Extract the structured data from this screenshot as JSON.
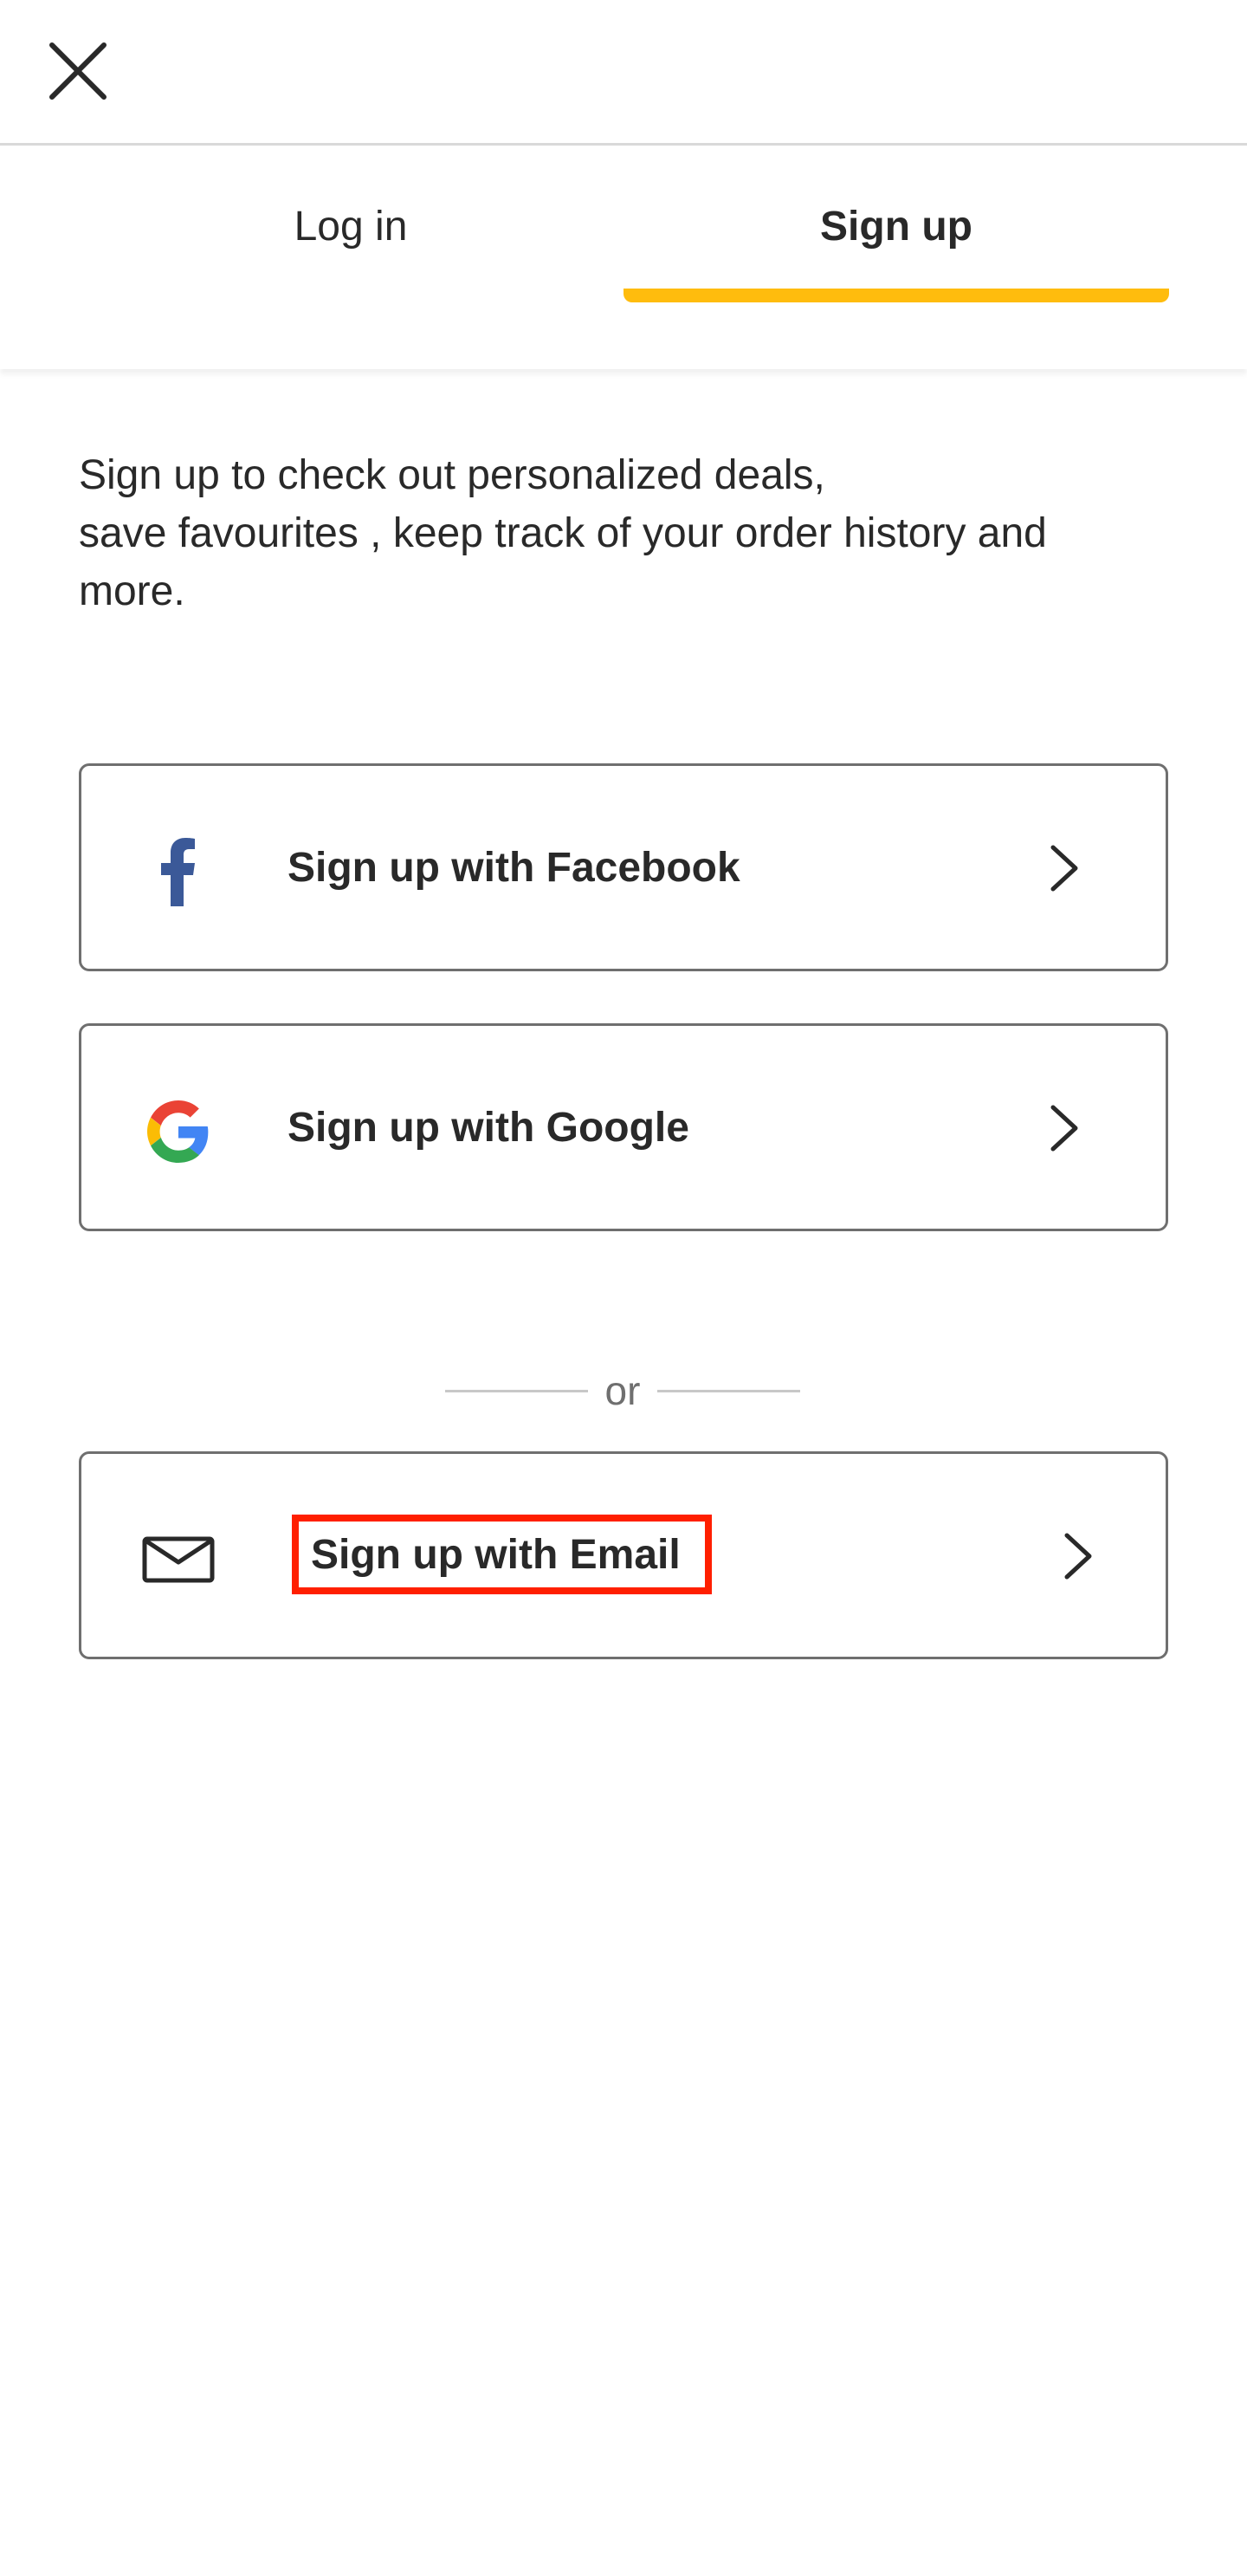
{
  "header": {
    "close_icon": "close-icon"
  },
  "tabs": [
    {
      "label": "Log in",
      "active": false
    },
    {
      "label": "Sign up",
      "active": true
    }
  ],
  "colors": {
    "accent": "#ffbc0d",
    "text": "#292929",
    "border": "#6f6f6f",
    "highlight": "#ff1f00",
    "facebook": "#3b5998"
  },
  "intro": {
    "line1": "Sign up to check out personalized deals,",
    "line2": "save favourites , keep track of your order history and",
    "line3": "more."
  },
  "buttons": {
    "facebook": {
      "label": "Sign up with Facebook",
      "icon": "facebook-icon"
    },
    "google": {
      "label": "Sign up with Google",
      "icon": "google-icon"
    },
    "email": {
      "label": "Sign up with Email",
      "icon": "envelope-icon"
    }
  },
  "divider": {
    "label": "or"
  }
}
